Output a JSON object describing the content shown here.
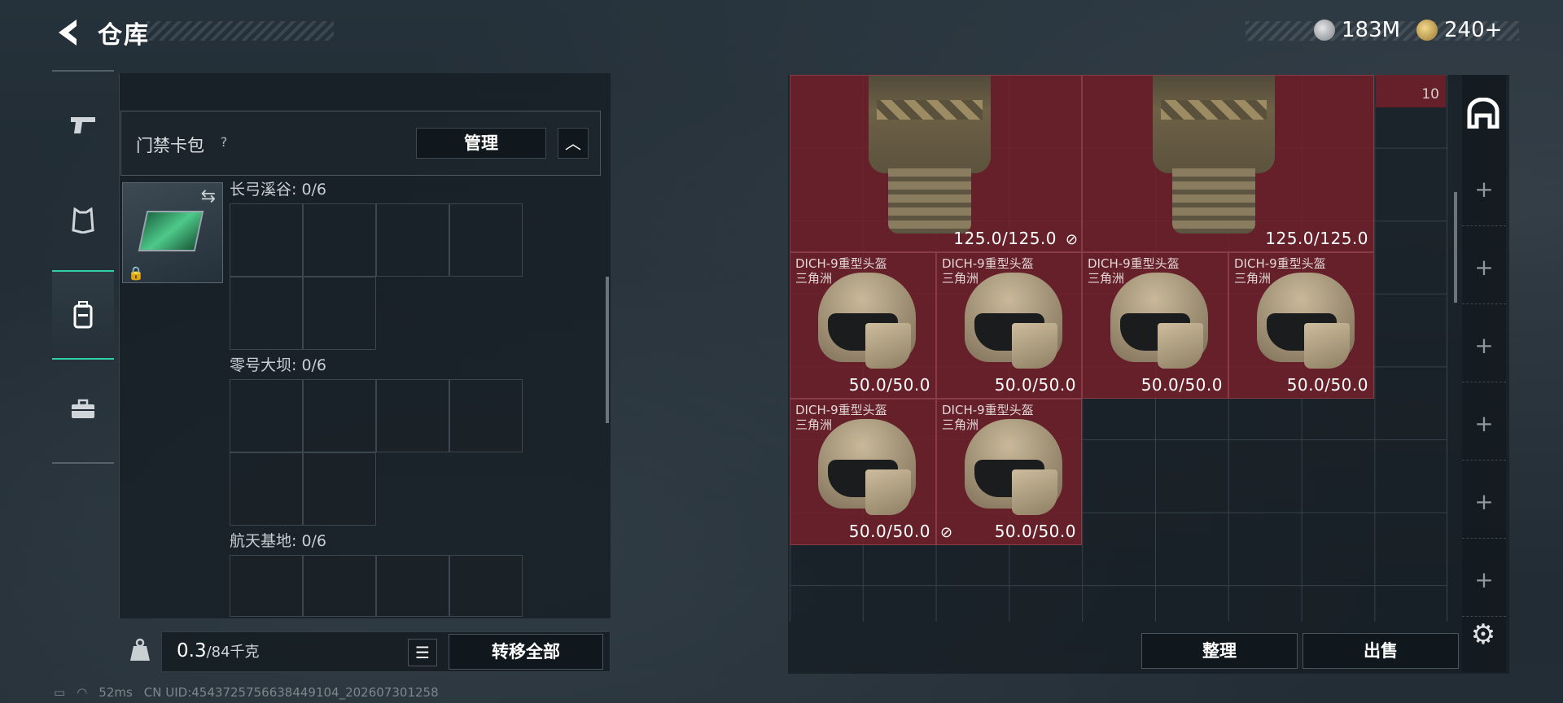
{
  "header": {
    "title": "仓库",
    "back_icon": "back-arrow-icon"
  },
  "currency": {
    "silver": "183M",
    "gold": "240+"
  },
  "category_tabs": [
    {
      "icon": "pistol-icon",
      "active": false
    },
    {
      "icon": "armor-icon",
      "active": false
    },
    {
      "icon": "backpack-icon",
      "active": true
    },
    {
      "icon": "toolbox-icon",
      "active": false
    }
  ],
  "card_pack": {
    "title": "门禁卡包",
    "help": "?",
    "manage_label": "管理",
    "collapse_icon": "chevron-up-icon",
    "maps": [
      {
        "label": "长弓溪谷: 0/6"
      },
      {
        "label": "零号大坝: 0/6"
      },
      {
        "label": "航天基地: 0/6"
      }
    ]
  },
  "bottom_left": {
    "weight_value": "0.3",
    "weight_capacity": "/84千克",
    "transfer_all_label": "转移全部"
  },
  "status_bar": {
    "ping": "52ms",
    "uid": "CN UID:4543725756638449104_202607301258"
  },
  "storage": {
    "count_badge": "10",
    "vests": [
      {
        "durability": "125.0/125.0",
        "unbound": true
      },
      {
        "durability": "125.0/125.0",
        "unbound": false
      }
    ],
    "helmets": [
      {
        "name": "DICH-9重型头盔",
        "origin": "三角洲",
        "durability": "50.0/50.0",
        "unbound": false
      },
      {
        "name": "DICH-9重型头盔",
        "origin": "三角洲",
        "durability": "50.0/50.0",
        "unbound": false
      },
      {
        "name": "DICH-9重型头盔",
        "origin": "三角洲",
        "durability": "50.0/50.0",
        "unbound": false
      },
      {
        "name": "DICH-9重型头盔",
        "origin": "三角洲",
        "durability": "50.0/50.0",
        "unbound": false
      },
      {
        "name": "DICH-9重型头盔",
        "origin": "三角洲",
        "durability": "50.0/50.0",
        "unbound": true
      },
      {
        "name": "DICH-9重型头盔",
        "origin": "三角洲",
        "durability": "50.0/50.0",
        "unbound": false
      }
    ],
    "sort_label": "整理",
    "sell_label": "出售"
  },
  "colors": {
    "accent": "#2fd0a4",
    "item_bg": "#76202a"
  }
}
